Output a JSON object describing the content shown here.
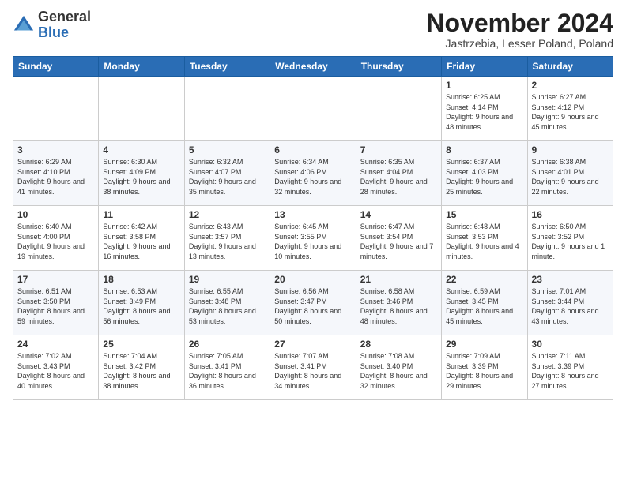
{
  "logo": {
    "general": "General",
    "blue": "Blue"
  },
  "header": {
    "month_title": "November 2024",
    "location": "Jastrzebia, Lesser Poland, Poland"
  },
  "days_of_week": [
    "Sunday",
    "Monday",
    "Tuesday",
    "Wednesday",
    "Thursday",
    "Friday",
    "Saturday"
  ],
  "weeks": [
    [
      {
        "day": "",
        "info": ""
      },
      {
        "day": "",
        "info": ""
      },
      {
        "day": "",
        "info": ""
      },
      {
        "day": "",
        "info": ""
      },
      {
        "day": "",
        "info": ""
      },
      {
        "day": "1",
        "info": "Sunrise: 6:25 AM\nSunset: 4:14 PM\nDaylight: 9 hours and 48 minutes."
      },
      {
        "day": "2",
        "info": "Sunrise: 6:27 AM\nSunset: 4:12 PM\nDaylight: 9 hours and 45 minutes."
      }
    ],
    [
      {
        "day": "3",
        "info": "Sunrise: 6:29 AM\nSunset: 4:10 PM\nDaylight: 9 hours and 41 minutes."
      },
      {
        "day": "4",
        "info": "Sunrise: 6:30 AM\nSunset: 4:09 PM\nDaylight: 9 hours and 38 minutes."
      },
      {
        "day": "5",
        "info": "Sunrise: 6:32 AM\nSunset: 4:07 PM\nDaylight: 9 hours and 35 minutes."
      },
      {
        "day": "6",
        "info": "Sunrise: 6:34 AM\nSunset: 4:06 PM\nDaylight: 9 hours and 32 minutes."
      },
      {
        "day": "7",
        "info": "Sunrise: 6:35 AM\nSunset: 4:04 PM\nDaylight: 9 hours and 28 minutes."
      },
      {
        "day": "8",
        "info": "Sunrise: 6:37 AM\nSunset: 4:03 PM\nDaylight: 9 hours and 25 minutes."
      },
      {
        "day": "9",
        "info": "Sunrise: 6:38 AM\nSunset: 4:01 PM\nDaylight: 9 hours and 22 minutes."
      }
    ],
    [
      {
        "day": "10",
        "info": "Sunrise: 6:40 AM\nSunset: 4:00 PM\nDaylight: 9 hours and 19 minutes."
      },
      {
        "day": "11",
        "info": "Sunrise: 6:42 AM\nSunset: 3:58 PM\nDaylight: 9 hours and 16 minutes."
      },
      {
        "day": "12",
        "info": "Sunrise: 6:43 AM\nSunset: 3:57 PM\nDaylight: 9 hours and 13 minutes."
      },
      {
        "day": "13",
        "info": "Sunrise: 6:45 AM\nSunset: 3:55 PM\nDaylight: 9 hours and 10 minutes."
      },
      {
        "day": "14",
        "info": "Sunrise: 6:47 AM\nSunset: 3:54 PM\nDaylight: 9 hours and 7 minutes."
      },
      {
        "day": "15",
        "info": "Sunrise: 6:48 AM\nSunset: 3:53 PM\nDaylight: 9 hours and 4 minutes."
      },
      {
        "day": "16",
        "info": "Sunrise: 6:50 AM\nSunset: 3:52 PM\nDaylight: 9 hours and 1 minute."
      }
    ],
    [
      {
        "day": "17",
        "info": "Sunrise: 6:51 AM\nSunset: 3:50 PM\nDaylight: 8 hours and 59 minutes."
      },
      {
        "day": "18",
        "info": "Sunrise: 6:53 AM\nSunset: 3:49 PM\nDaylight: 8 hours and 56 minutes."
      },
      {
        "day": "19",
        "info": "Sunrise: 6:55 AM\nSunset: 3:48 PM\nDaylight: 8 hours and 53 minutes."
      },
      {
        "day": "20",
        "info": "Sunrise: 6:56 AM\nSunset: 3:47 PM\nDaylight: 8 hours and 50 minutes."
      },
      {
        "day": "21",
        "info": "Sunrise: 6:58 AM\nSunset: 3:46 PM\nDaylight: 8 hours and 48 minutes."
      },
      {
        "day": "22",
        "info": "Sunrise: 6:59 AM\nSunset: 3:45 PM\nDaylight: 8 hours and 45 minutes."
      },
      {
        "day": "23",
        "info": "Sunrise: 7:01 AM\nSunset: 3:44 PM\nDaylight: 8 hours and 43 minutes."
      }
    ],
    [
      {
        "day": "24",
        "info": "Sunrise: 7:02 AM\nSunset: 3:43 PM\nDaylight: 8 hours and 40 minutes."
      },
      {
        "day": "25",
        "info": "Sunrise: 7:04 AM\nSunset: 3:42 PM\nDaylight: 8 hours and 38 minutes."
      },
      {
        "day": "26",
        "info": "Sunrise: 7:05 AM\nSunset: 3:41 PM\nDaylight: 8 hours and 36 minutes."
      },
      {
        "day": "27",
        "info": "Sunrise: 7:07 AM\nSunset: 3:41 PM\nDaylight: 8 hours and 34 minutes."
      },
      {
        "day": "28",
        "info": "Sunrise: 7:08 AM\nSunset: 3:40 PM\nDaylight: 8 hours and 32 minutes."
      },
      {
        "day": "29",
        "info": "Sunrise: 7:09 AM\nSunset: 3:39 PM\nDaylight: 8 hours and 29 minutes."
      },
      {
        "day": "30",
        "info": "Sunrise: 7:11 AM\nSunset: 3:39 PM\nDaylight: 8 hours and 27 minutes."
      }
    ]
  ]
}
